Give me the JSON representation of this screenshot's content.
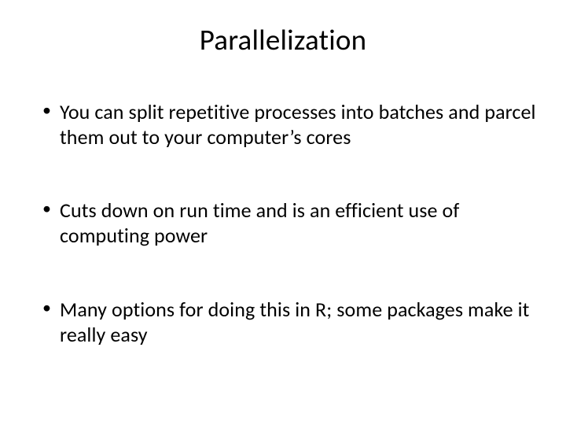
{
  "title": "Parallelization",
  "bullets": [
    "You can split repetitive processes into batches and parcel them out to your computer’s cores",
    "Cuts down on run time and is an efficient use of computing power",
    "Many options for doing this in R; some packages make it really easy"
  ]
}
